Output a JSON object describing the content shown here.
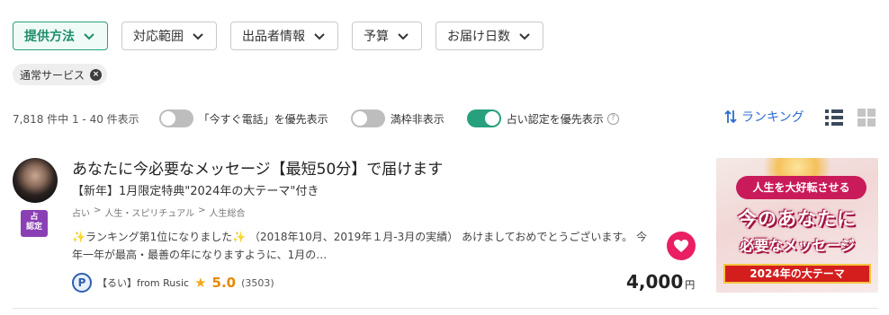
{
  "filters": [
    {
      "label": "提供方法",
      "active": true
    },
    {
      "label": "対応範囲",
      "active": false
    },
    {
      "label": "出品者情報",
      "active": false
    },
    {
      "label": "予算",
      "active": false
    },
    {
      "label": "お届け日数",
      "active": false
    }
  ],
  "active_tag": {
    "label": "通常サービス"
  },
  "toolbar": {
    "result_count": "7,818 件中 1 - 40 件表示",
    "toggle_phone": {
      "label": "「今すぐ電話」を優先表示",
      "on": false
    },
    "toggle_full": {
      "label": "満枠非表示",
      "on": false
    },
    "toggle_certified": {
      "label": "占い認定を優先表示",
      "on": true
    },
    "help_glyph": "?",
    "ranking_label": "ランキング"
  },
  "listing": {
    "title": "あなたに今必要なメッセージ【最短50分】で届けます",
    "subtitle": "【新年】1月限定特典\"2024年の大テーマ\"付き",
    "breadcrumbs": [
      "占い",
      ">",
      "人生・スピリチュアル",
      ">",
      "人生総合"
    ],
    "badge": "占\n認定",
    "description": "✨ランキング第1位になりました✨ （2018年10月、2019年１月-3月の実績） あけましておめでとうございます。 今年一年が最高・最善の年になりますように、1月の…",
    "seller_name": "【るい】from Rusic",
    "seller_logo": "P",
    "rating": "5.0",
    "reviews": "(3503)",
    "price": "4,000",
    "currency": "円",
    "thumbnail": {
      "line1": "人生を大好転させる",
      "line2": "今のあなたに",
      "line3": "必要なメッセージ",
      "line4": "2024年の大テーマ"
    }
  },
  "colors": {
    "accent": "#27a07d",
    "link": "#2d6cd0",
    "favorite": "#e91e63",
    "badge": "#8a3fb5"
  }
}
